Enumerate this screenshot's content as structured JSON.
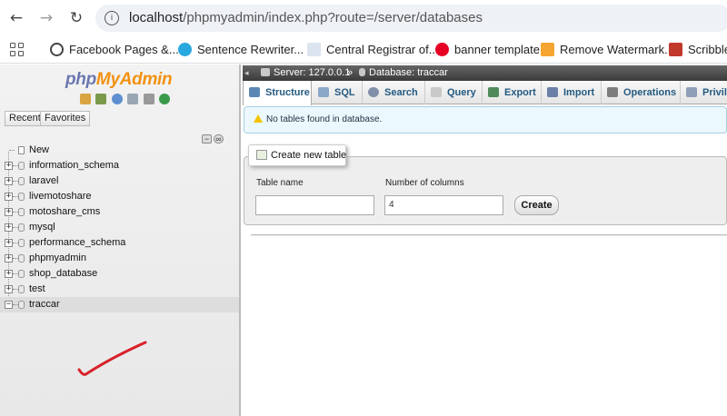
{
  "browser": {
    "url_host": "localhost",
    "url_path": "/phpmyadmin/index.php?route=/server/databases",
    "bookmarks": [
      {
        "label": "Facebook Pages &...",
        "color": "#1877f2"
      },
      {
        "label": "Sentence Rewriter...",
        "color": "#29a8e0"
      },
      {
        "label": "Central Registrar of...",
        "color": "#8aa4c8"
      },
      {
        "label": "banner template",
        "color": "#e60023"
      },
      {
        "label": "Remove Watermark...",
        "color": "#f7a531"
      },
      {
        "label": "Scribble E",
        "color": "#c0392b"
      }
    ]
  },
  "sidebar": {
    "logo_php": "php",
    "logo_myadmin": "MyAdmin",
    "tab_recent": "Recent",
    "tab_favorites": "Favorites",
    "tree": [
      {
        "label": "New",
        "expander": ""
      },
      {
        "label": "information_schema",
        "expander": "+"
      },
      {
        "label": "laravel",
        "expander": "+"
      },
      {
        "label": "livemotoshare",
        "expander": "+"
      },
      {
        "label": "motoshare_cms",
        "expander": "+"
      },
      {
        "label": "mysql",
        "expander": "+"
      },
      {
        "label": "performance_schema",
        "expander": "+"
      },
      {
        "label": "phpmyadmin",
        "expander": "+"
      },
      {
        "label": "shop_database",
        "expander": "+"
      },
      {
        "label": "test",
        "expander": "+"
      },
      {
        "label": "traccar",
        "expander": "−"
      }
    ]
  },
  "breadcrumb": {
    "server": "Server: 127.0.0.1",
    "separator": "»",
    "database": "Database: traccar"
  },
  "tabs": [
    {
      "label": "Structure",
      "color": "#5b87b5"
    },
    {
      "label": "SQL",
      "color": "#8aa8c8"
    },
    {
      "label": "Search",
      "color": "#8090a8"
    },
    {
      "label": "Query",
      "color": "#b0b0b0"
    },
    {
      "label": "Export",
      "color": "#4e8a5a"
    },
    {
      "label": "Import",
      "color": "#6a7fa8"
    },
    {
      "label": "Operations",
      "color": "#7d7d7d"
    },
    {
      "label": "Privile",
      "color": "#8f9fb8"
    }
  ],
  "notice": "No tables found in database.",
  "create_table": {
    "legend": "Create new table",
    "table_name_label": "Table name",
    "table_name_value": "",
    "columns_label": "Number of columns",
    "columns_value": "4",
    "create_button": "Create"
  }
}
